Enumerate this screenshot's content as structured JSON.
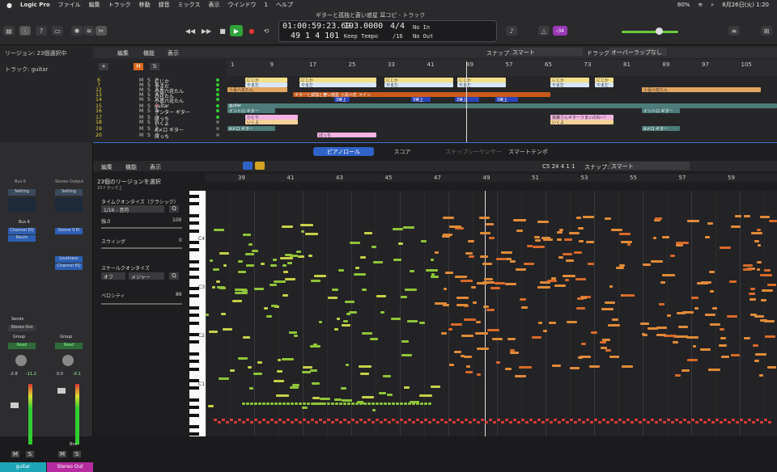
{
  "menubar": {
    "apple": "",
    "app": "Logic Pro",
    "items": [
      "ファイル",
      "編集",
      "トラック",
      "移動",
      "録音",
      "ミックス",
      "表示",
      "ウインドウ",
      "1",
      "ヘルプ"
    ],
    "battery": "80%",
    "datetime": "8月26日(火)  1:20"
  },
  "window": {
    "title": "ギターと孤独と蒼い惑星 耳コピ - トラック"
  },
  "lcd": {
    "position": "01:00:59:23.69",
    "bars": "49  1  4  101",
    "tempo": "193.0000",
    "tempo_mode": "Keep Tempo",
    "sig": "4/4",
    "div": "/16",
    "in": "No In",
    "out": "No Out"
  },
  "user_badge": "‹34",
  "tracks_bar": {
    "region_info": "リージョン: 23個選択中",
    "track_info": "トラック: guitar",
    "edit": "編集",
    "func": "機能",
    "view": "表示",
    "snap_label": "スナップ:",
    "snap_value": "スマート",
    "drag_label": "ドラッグ:",
    "drag_value": "オーバーラップなし"
  },
  "main_ruler": [
    "1",
    "9",
    "17",
    "25",
    "33",
    "41",
    "49",
    "57",
    "65",
    "73",
    "81",
    "89",
    "97",
    "105"
  ],
  "tracks": [
    {
      "num": "6",
      "name": "にじか"
    },
    {
      "num": "7",
      "name": "やまだ"
    },
    {
      "num": "12",
      "name": "小喜六花たん"
    },
    {
      "num": "13",
      "name": "六花たん"
    },
    {
      "num": "14",
      "name": "小喜六花たん"
    },
    {
      "num": "15",
      "name": "guitar"
    },
    {
      "num": "16",
      "name": "ゲンター ギター"
    },
    {
      "num": "17",
      "name": "ぼっち"
    },
    {
      "num": "18",
      "name": "いくよ"
    },
    {
      "num": "19",
      "name": "Aメロ ギター"
    },
    {
      "num": "20",
      "name": "ぼっち"
    }
  ],
  "region_labels": {
    "a": "にじか",
    "b": "やまだ",
    "c": "小喜六花たん",
    "d": "ギターと孤独と蒼い惑星 小喜六花_メイン",
    "e": "3実上",
    "f": "guitar",
    "g": "イントロ ギター",
    "h": "ひとり",
    "i": "いくよ",
    "j": "Aメロ ギター",
    "k": "後藤さんギターうまいのね~!",
    "l": "ぼっち"
  },
  "inspector": {
    "sel_title": "23個のリージョンを選択",
    "sel_sub": "10トラック上",
    "tq_label": "タイムクオンタイズ（クラシック）",
    "tq_value": "1/16 - 音符",
    "q": "Q",
    "strength_label": "強さ",
    "strength_value": "100",
    "swing_label": "スウィング",
    "swing_value": "0",
    "scale_label": "スケールクオンタイズ",
    "scale_off": "オフ",
    "scale_value": "メジャー",
    "velocity_label": "ベロシティ",
    "velocity_value": "86",
    "ch1": {
      "setting": "Setting",
      "eq": "Channel EQ",
      "plug2": "Raum",
      "bus": "Bus 6",
      "sends": "Sends",
      "out": "Stereo Out",
      "group": "Group",
      "read": "Read",
      "vol": "-2.8",
      "peak": "-11.2",
      "mute": "M",
      "solo": "S",
      "name": "guitar",
      "name_hdr": "Bus 6"
    },
    "ch2": {
      "setting": "Setting",
      "eq": "Ozone 9 El",
      "plug2": "Loudness",
      "plug3": "Channel EQ",
      "group": "Group",
      "read": "Read",
      "vol": "0.0",
      "peak": "-0.1",
      "bnc": "Bnc",
      "mute": "M",
      "solo": "S",
      "name": "Stereo Out",
      "name_hdr": "Stereo Output"
    }
  },
  "editor": {
    "tabs": [
      "ピアノロール",
      "スコア",
      "ステップシーケンサー",
      "スマートテンポ"
    ],
    "edit": "編集",
    "func": "機能",
    "view": "表示",
    "pos": "C5  24 4 1 1",
    "snap_label": "スナップ:",
    "snap_value": "スマート"
  },
  "piano_ruler": [
    "39",
    "41",
    "43",
    "45",
    "47",
    "49",
    "51",
    "53",
    "55",
    "57",
    "59"
  ],
  "octave_labels": [
    "C4",
    "C3",
    "C2",
    "C1"
  ]
}
